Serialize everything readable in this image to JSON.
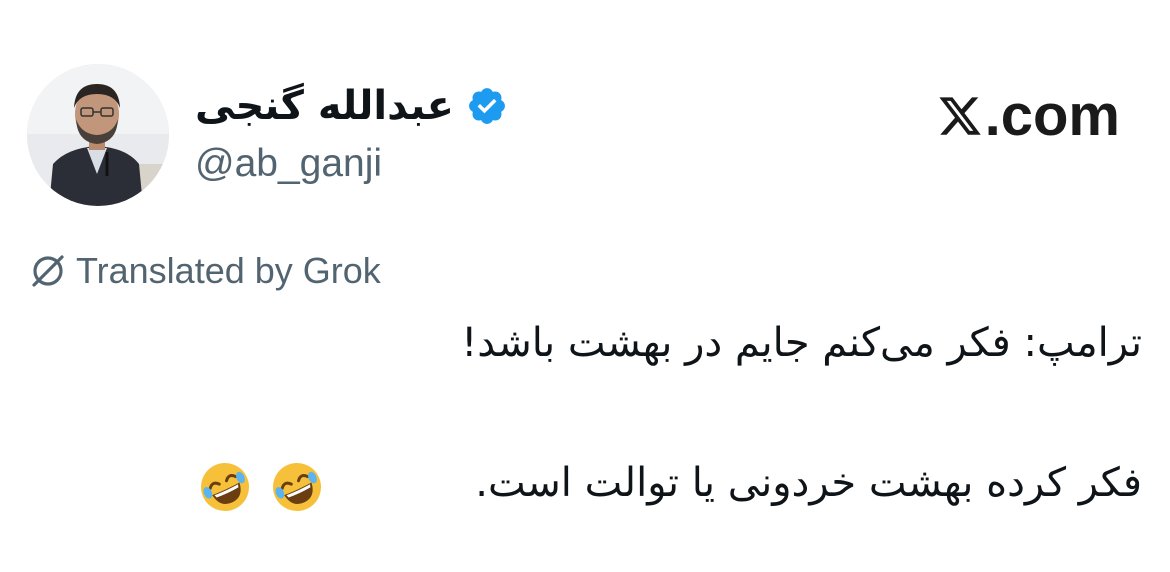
{
  "author": {
    "display_name": "عبدالله گنجی",
    "handle": "@ab_ganji",
    "avatar": "avatar-photo",
    "verified": true,
    "verified_icon": "verified-badge-icon",
    "verified_color": "#1d9bf0"
  },
  "site": {
    "label": ".com",
    "icon": "x-logo-icon"
  },
  "translation": {
    "label": "Translated by Grok",
    "icon": "grok-icon"
  },
  "tweet": {
    "line1": "ترامپ: فکر می‌کنم جایم در بهشت باشد!",
    "line2": "فکر کرده بهشت خردونی یا توالت است.",
    "emojis": [
      "rolling-on-floor-laughing-emoji",
      "rolling-on-floor-laughing-emoji"
    ]
  }
}
